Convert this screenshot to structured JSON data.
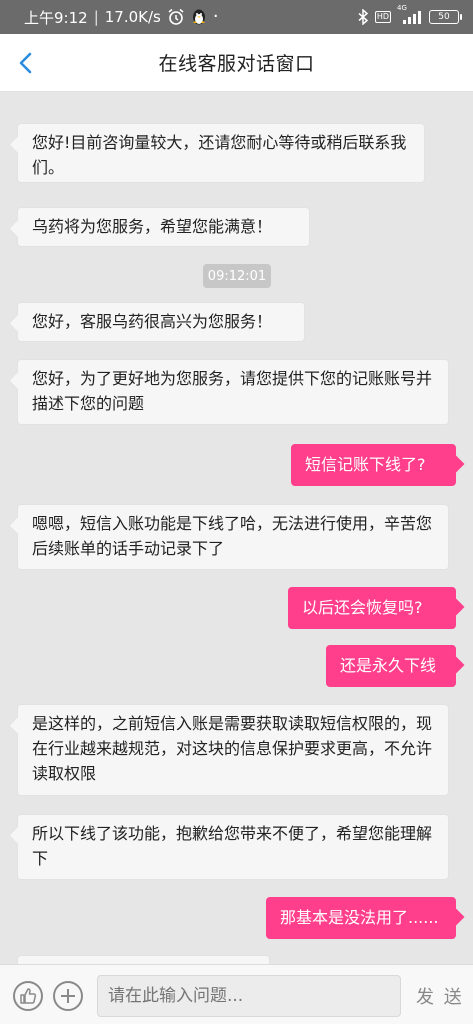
{
  "status_bar": {
    "time": "上午9:12",
    "net_speed": "17.0K/s",
    "signal_label": "4G",
    "hd_label": "HD",
    "battery": "50"
  },
  "nav": {
    "title": "在线客服对话窗口"
  },
  "messages": [
    {
      "dir": "in",
      "text": "您好!目前咨询量较大，还请您耐心等待或稍后联系我们。"
    },
    {
      "dir": "in",
      "text": "乌药将为您服务，希望您能满意！"
    },
    {
      "dir": "time",
      "text": "09:12:01"
    },
    {
      "dir": "in",
      "text": "您好，客服乌药很高兴为您服务！"
    },
    {
      "dir": "in",
      "text": "您好，为了更好地为您服务，请您提供下您的记账账号并描述下您的问题"
    },
    {
      "dir": "out",
      "text": "短信记账下线了?"
    },
    {
      "dir": "in",
      "text": "嗯嗯，短信入账功能是下线了哈，无法进行使用，辛苦您后续账单的话手动记录下了"
    },
    {
      "dir": "out",
      "text": "以后还会恢复吗?"
    },
    {
      "dir": "out",
      "text": "还是永久下线"
    },
    {
      "dir": "in",
      "text": "是这样的，之前短信入账是需要获取读取短信权限的，现在行业越来越规范，对这块的信息保护要求更高，不允许读取权限"
    },
    {
      "dir": "in",
      "text": "所以下线了该功能，抱歉给您带来不便了，希望您能理解下"
    },
    {
      "dir": "out",
      "text": "那基本是没法用了......"
    }
  ],
  "input": {
    "placeholder": "请在此输入问题..."
  },
  "send_label": "发 送",
  "colors": {
    "accent": "#ff3f8b",
    "back_arrow": "#2a8de0",
    "status_bar_bg": "#6b6b6b",
    "chat_bg": "#e6e6e6"
  },
  "icons": {
    "back": "chevron-left-icon",
    "like": "thumbs-up-icon",
    "add": "plus-icon"
  }
}
